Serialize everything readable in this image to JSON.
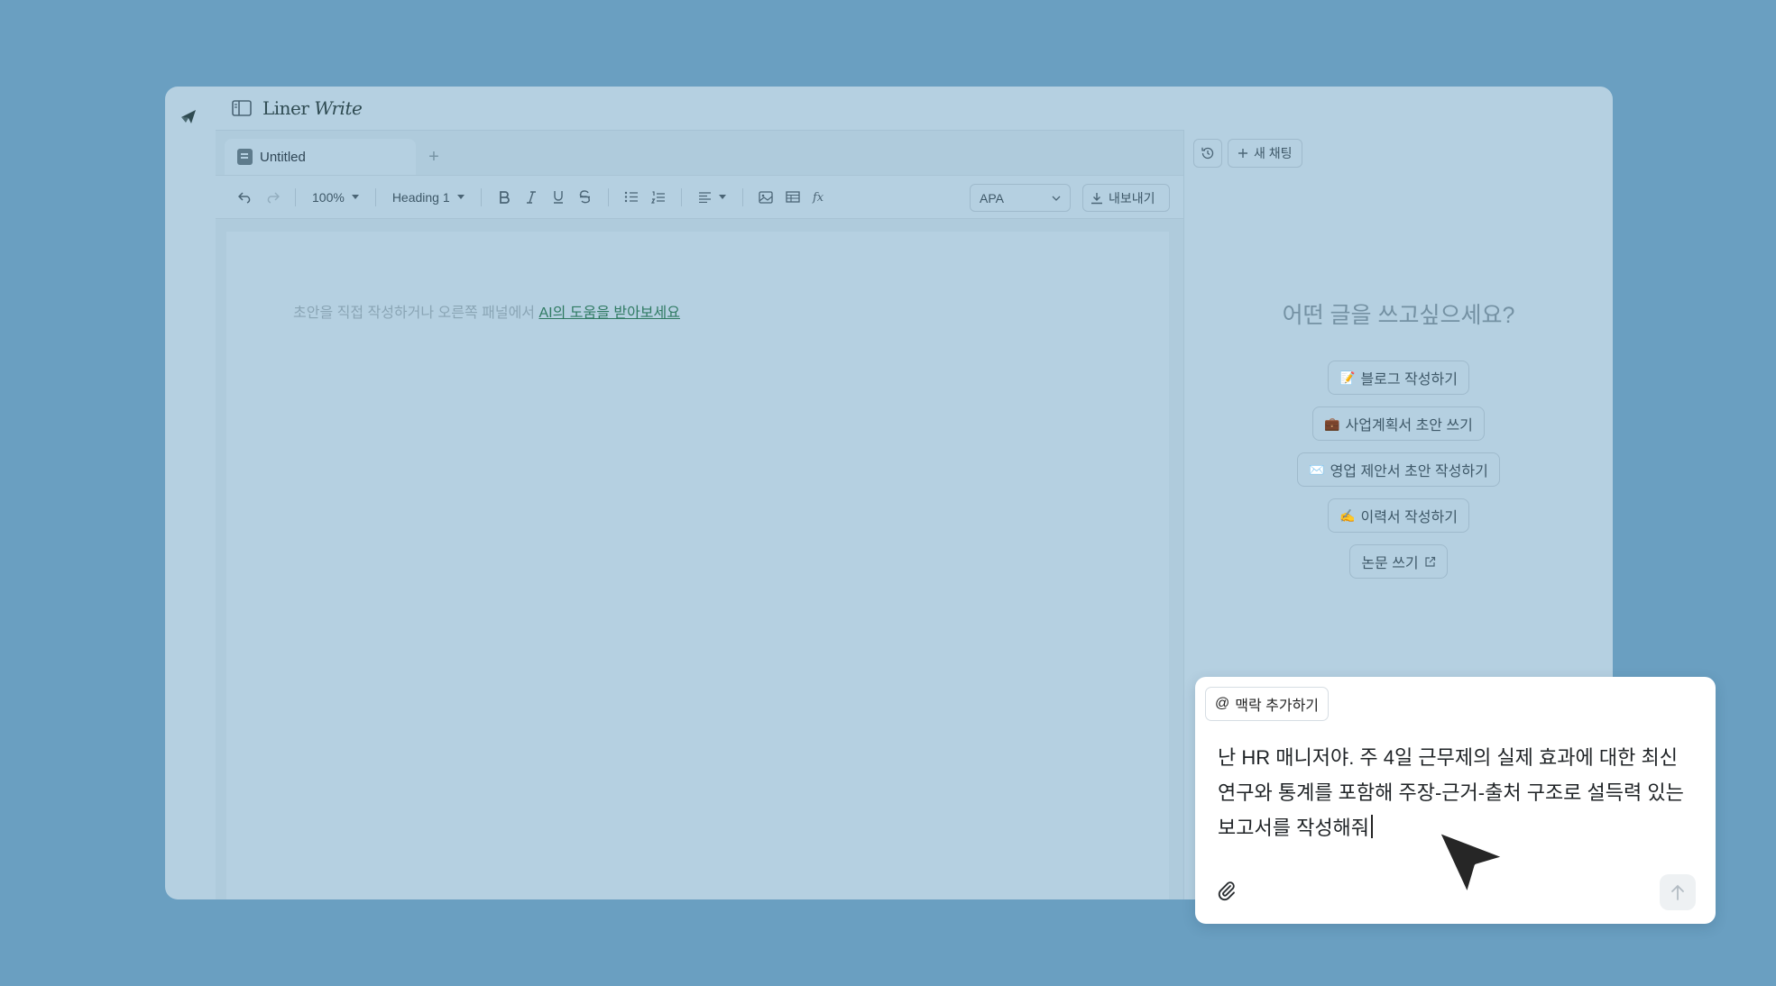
{
  "app": {
    "brand_name": "Liner",
    "brand_suffix": "Write"
  },
  "tabs": [
    {
      "label": "Untitled"
    }
  ],
  "toolbar": {
    "zoom": "100%",
    "heading": "Heading 1",
    "citation_style": "APA",
    "export_label": "내보내기"
  },
  "editor": {
    "placeholder_prefix": "초안을 직접 작성하거나 오른쪽 패널에서 ",
    "placeholder_link": "AI의 도움을 받아보세요"
  },
  "panel": {
    "new_chat_label": "새 채팅",
    "prompt_title": "어떤 글을 쓰고싶으세요?",
    "suggestions": [
      {
        "emoji": "📝",
        "label": "블로그 작성하기"
      },
      {
        "emoji": "💼",
        "label": "사업계획서 초안 쓰기"
      },
      {
        "emoji": "✉️",
        "label": "영업 제안서 초안 작성하기"
      },
      {
        "emoji": "✍️",
        "label": "이력서 작성하기"
      },
      {
        "emoji": "",
        "label": "논문 쓰기"
      }
    ]
  },
  "chat": {
    "context_label": "맥락 추가하기",
    "message": "난 HR 매니저야. 주 4일 근무제의 실제 효과에 대한 최신 연구와 통계를 포함해 주장-근거-출처 구조로 설득력 있는 보고서를 작성해줘"
  },
  "colors": {
    "background": "#6a9fc1",
    "app_overlay": "#b5d0e1",
    "link": "#2f7a62"
  }
}
